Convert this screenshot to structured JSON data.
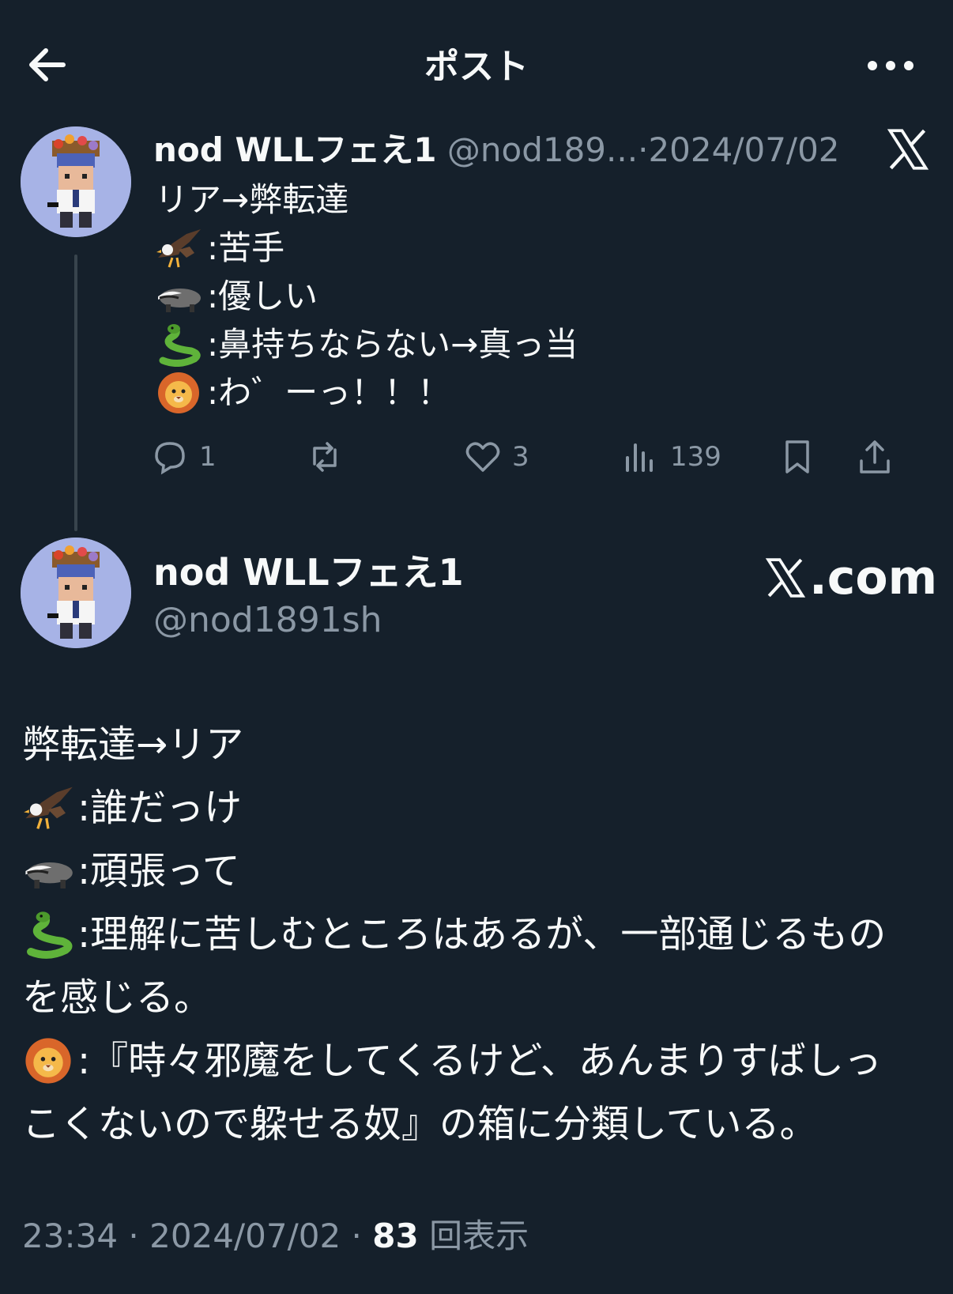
{
  "header": {
    "title": "ポスト"
  },
  "tweet1": {
    "name": "nod WLLフェえ1",
    "handle": "@nod189...",
    "sep": "·",
    "date": "2024/07/02",
    "lines": [
      {
        "emoji": "",
        "text": "リア→弊転達"
      },
      {
        "emoji": "eagle",
        "text": ":苦手"
      },
      {
        "emoji": "badger",
        "text": ":優しい"
      },
      {
        "emoji": "snake",
        "text": ":鼻持ちならない→真っ当"
      },
      {
        "emoji": "lion",
        "text": ":わ゛ーっ！！！"
      }
    ],
    "replies": "1",
    "likes": "3",
    "views": "139"
  },
  "tweet2": {
    "name": "nod WLLフェえ1",
    "handle": "@nod1891sh",
    "brand": ".com",
    "lines": [
      {
        "emoji": "",
        "text": "弊転達→リア"
      },
      {
        "emoji": "eagle",
        "text": ":誰だっけ"
      },
      {
        "emoji": "badger",
        "text": ":頑張って"
      },
      {
        "emoji": "snake",
        "text": ":理解に苦しむところはあるが、一部通じるもの",
        "cont": "を感じる。"
      },
      {
        "emoji": "lion",
        "text": ":『時々邪魔をしてくるけど、あんまりすばしっ",
        "cont": "こくないので躱せる奴』の箱に分類している。"
      }
    ],
    "time": "23:34",
    "date": "2024/07/02",
    "views_count": "83",
    "views_label": "回表示"
  },
  "icons": [
    "back-arrow-icon",
    "more-icon",
    "x-logo-icon",
    "reply-icon",
    "repost-icon",
    "like-icon",
    "views-icon",
    "bookmark-icon",
    "share-icon",
    "eagle-emoji",
    "badger-emoji",
    "snake-emoji",
    "lion-emoji"
  ],
  "colors": {
    "background": "#15202b",
    "text": "#f7f9f9",
    "muted": "#8b98a5",
    "avatar_bg": "#a7b3e6"
  }
}
